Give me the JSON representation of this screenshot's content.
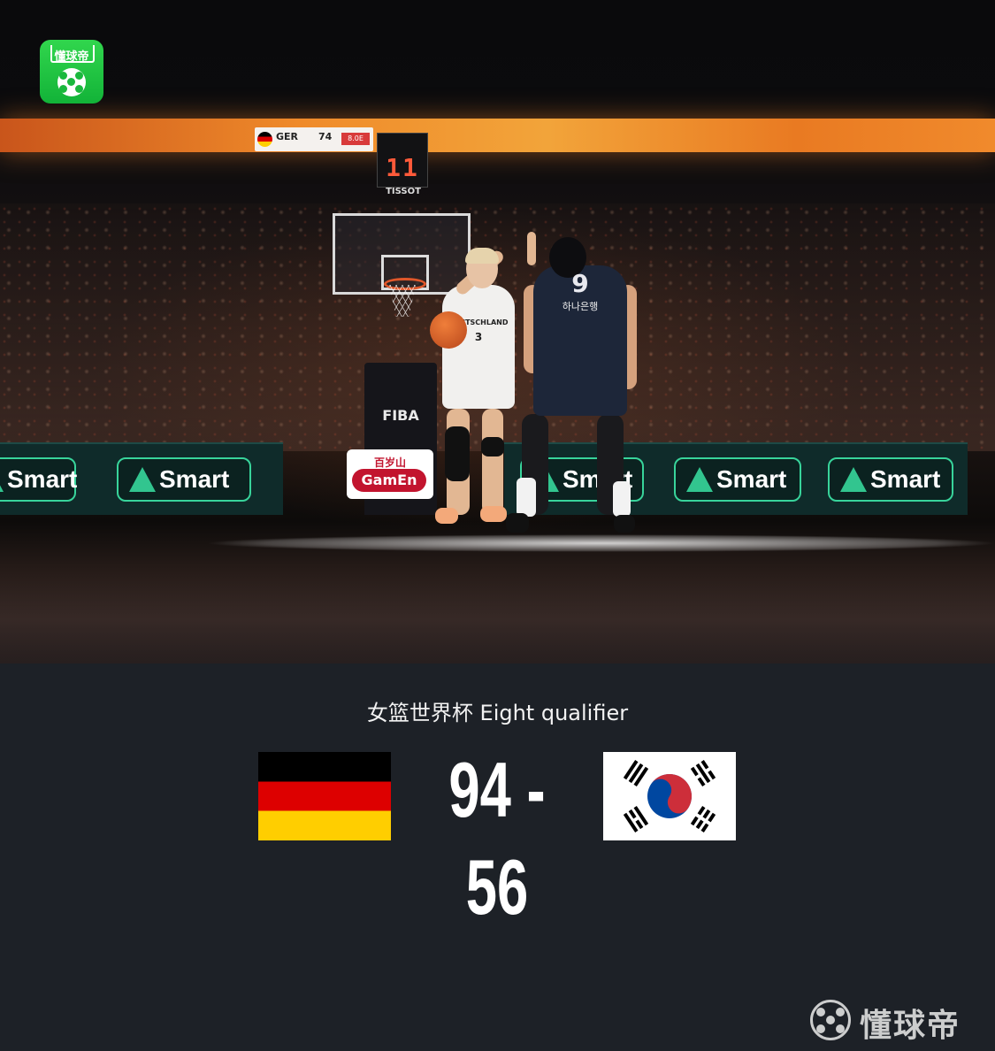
{
  "app": {
    "logo_text": "懂球帝"
  },
  "scene": {
    "scorebug_team": "GER",
    "scorebug_points": "74",
    "scorebug_clock": "8.0E",
    "shot_clock": "11",
    "timing_brand": "TISSOT",
    "stanchion_brand": "FIBA",
    "sponsor_cn": "百岁山",
    "sponsor_en": "GamEn",
    "led_sponsor": "Smart",
    "player1_jersey_text": "DEUTSCHLAND",
    "player1_number": "3",
    "player2_number": "9",
    "player2_sponsor": "하나은행"
  },
  "match": {
    "title": "女篮世界杯 Eight qualifier",
    "score": "94 - 56",
    "home_flag": "germany-flag",
    "away_flag": "south-korea-flag"
  },
  "watermark": {
    "text": "懂球帝"
  },
  "colors": {
    "background": "#1d2127",
    "brand_green": "#1ab83d",
    "led_green": "#38d49b",
    "de_black": "#000000",
    "de_red": "#dd0000",
    "de_gold": "#ffce00",
    "kr_red": "#cd2e3a",
    "kr_blue": "#0047a0"
  }
}
